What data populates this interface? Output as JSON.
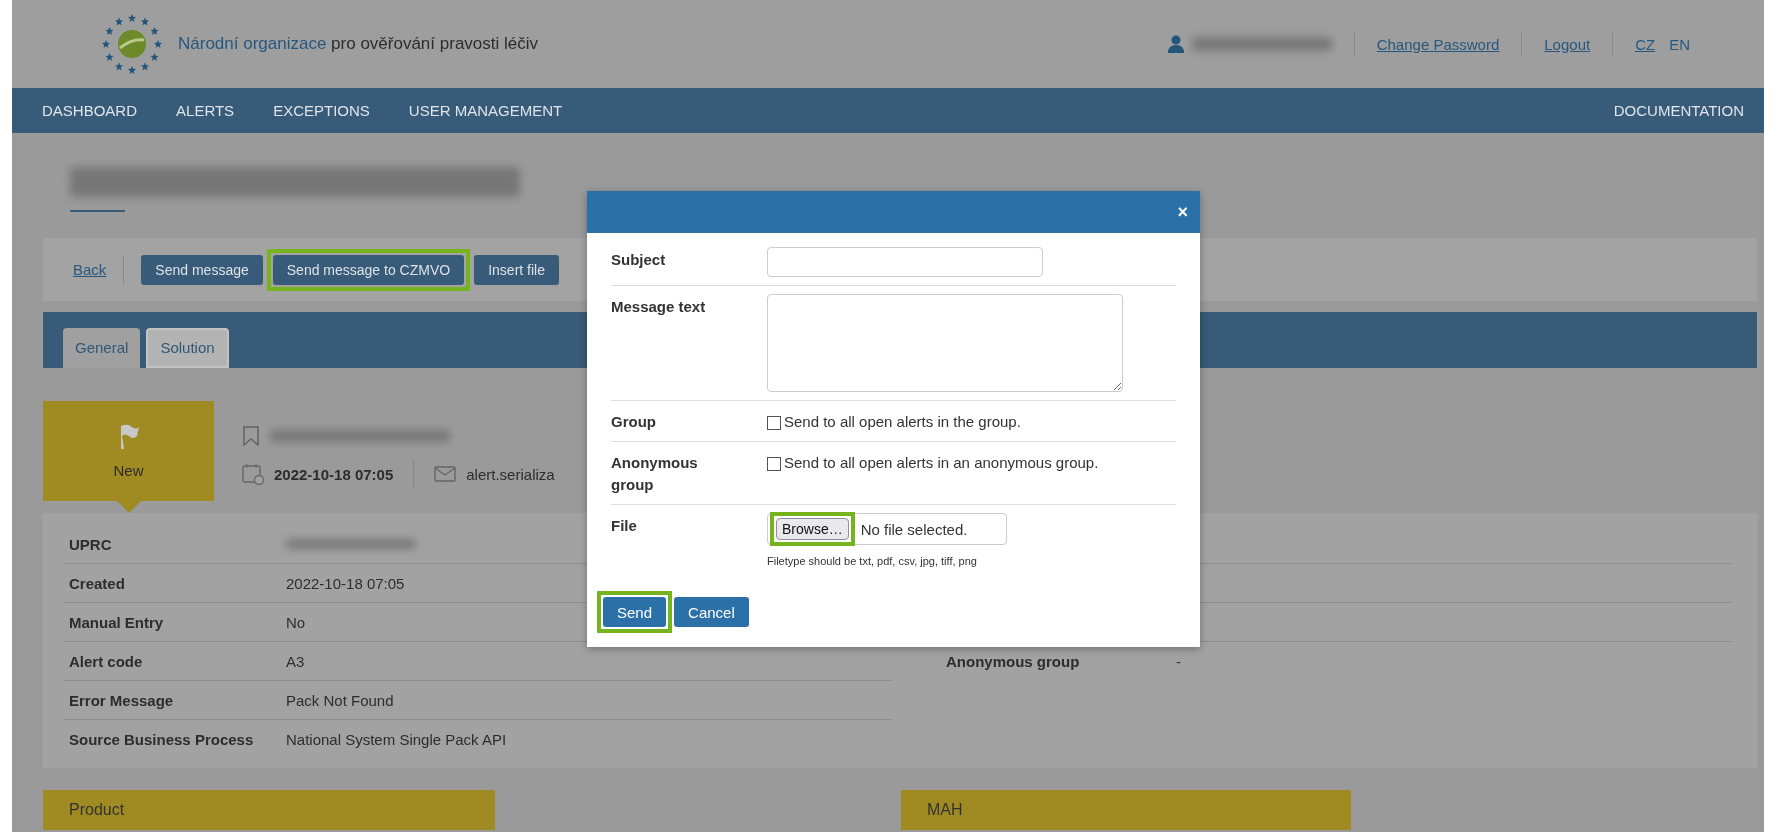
{
  "header": {
    "org_name_highlight": "Národní organizace",
    "org_name_rest": "pro ověřování pravosti léčiv",
    "links": [
      {
        "label": "Change Password"
      },
      {
        "label": "Logout"
      }
    ],
    "languages": [
      {
        "label": "CZ",
        "selected": false
      },
      {
        "label": "EN",
        "selected": true
      }
    ]
  },
  "nav": {
    "items": [
      "DASHBOARD",
      "ALERTS",
      "EXCEPTIONS",
      "USER MANAGEMENT"
    ],
    "right": "DOCUMENTATION"
  },
  "toolbar": {
    "back": "Back",
    "buttons": [
      {
        "label": "Send message",
        "highlighted": false
      },
      {
        "label": "Send message to CZMVO",
        "highlighted": true
      },
      {
        "label": "Insert file",
        "highlighted": false
      }
    ]
  },
  "tabs": [
    {
      "label": "General",
      "selected": true
    },
    {
      "label": "Solution",
      "selected": false
    }
  ],
  "status": {
    "label": "New"
  },
  "meta": {
    "date": "2022-10-18 07:05",
    "email": "alert.serializa"
  },
  "details": [
    {
      "label": "UPRC"
    },
    {
      "label": "Created",
      "value": "2022-10-18 07:05"
    },
    {
      "label": "Manual Entry",
      "value": "No"
    },
    {
      "label": "Alert code",
      "value": "A3"
    },
    {
      "label": "Error Message",
      "value": "Pack Not Found"
    },
    {
      "label": "Source Business Process",
      "value": "National System Single Pack API"
    }
  ],
  "details_right": [
    {
      "label": "Anonymous group",
      "value": "-"
    }
  ],
  "sections": [
    "Product",
    "MAH"
  ],
  "dialog": {
    "close": "×",
    "fields": [
      {
        "kind": "text",
        "label": "Subject"
      },
      {
        "kind": "textarea",
        "label": "Message text"
      },
      {
        "kind": "checkbox",
        "label": "Group",
        "text": "Send to all open alerts in the group.",
        "checked": false
      },
      {
        "kind": "checkbox",
        "label": "Anonymous group",
        "text": "Send to all open alerts in an anonymous group.",
        "checked": false
      },
      {
        "kind": "file",
        "label": "File",
        "button": "Browse…",
        "status": "No file selected.",
        "hint": "Filetype should be txt, pdf, csv, jpg, tiff, png",
        "highlighted": true
      }
    ],
    "buttons": [
      {
        "label": "Send",
        "highlighted": true
      },
      {
        "label": "Cancel",
        "highlighted": false
      }
    ]
  }
}
